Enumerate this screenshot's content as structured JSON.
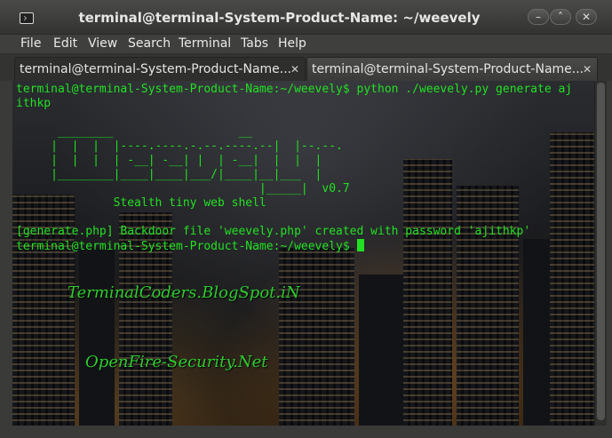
{
  "window": {
    "title": "terminal@terminal-System-Product-Name: ~/weevely",
    "icon": "terminal-icon",
    "controls": {
      "minimize": "–",
      "maximize": "˄",
      "close": "✕"
    }
  },
  "menu": {
    "file": "File",
    "edit": "Edit",
    "view": "View",
    "search": "Search",
    "terminal": "Terminal",
    "tabs": "Tabs",
    "help": "Help"
  },
  "tabs": [
    {
      "label": "terminal@terminal-System-Product-Name...",
      "close": "✕",
      "active": false
    },
    {
      "label": "terminal@terminal-System-Product-Name...",
      "close": "✕",
      "active": true
    }
  ],
  "terminal": {
    "lines": [
      "terminal@terminal-System-Product-Name:~/weevely$ python ./weevely.py generate aj",
      "ithkp",
      "",
      "      ________                  __",
      "     |  |  |  |----.----.-.--.----.--|  |--.--.",
      "     |  |  |  | -__| -__| |  | -__|  |  |  |",
      "     |________|____|____|___/|____|__|___  |",
      "                                   |_____|  v0.7",
      "              Stealth tiny web shell",
      "",
      "[generate.php] Backdoor file 'weevely.php' created with password 'ajithkp'",
      "terminal@terminal-System-Product-Name:~/weevely$ "
    ]
  },
  "watermarks": {
    "first": "TerminalCoders.BlogSpot.iN",
    "second": "OpenFire-Security.Net"
  },
  "colors": {
    "terminal_text": "#22e022",
    "titlebar": "#3c3c3a"
  }
}
